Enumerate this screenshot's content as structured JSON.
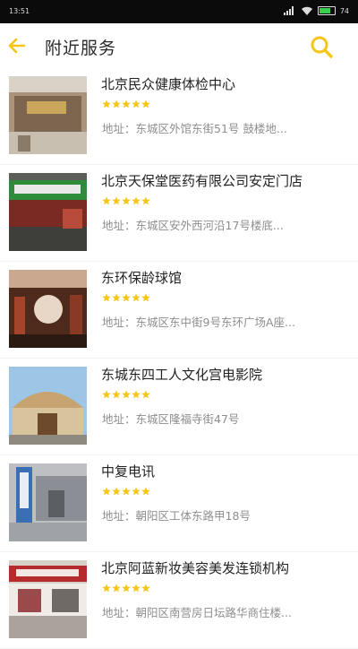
{
  "status_bar": {
    "time": "13:51",
    "battery_percent": "74"
  },
  "header": {
    "title": "附近服务"
  },
  "colors": {
    "accent": "#f5c518",
    "title_text": "#2a2a2a",
    "address_text": "#8e8e8e"
  },
  "rating_max": 5,
  "items": [
    {
      "name": "北京民众健康体检中心",
      "rating": 5,
      "address": "地址：东城区外馆东街51号 鼓楼地..."
    },
    {
      "name": "北京天保堂医药有限公司安定门店",
      "rating": 5,
      "address": "地址：东城区安外西河沿17号楼底..."
    },
    {
      "name": "东环保龄球馆",
      "rating": 5,
      "address": "地址：东城区东中街9号东环广场A座..."
    },
    {
      "name": "东城东四工人文化宫电影院",
      "rating": 5,
      "address": "地址：东城区隆福寺街47号"
    },
    {
      "name": "中复电讯",
      "rating": 5,
      "address": "地址：朝阳区工体东路甲18号"
    },
    {
      "name": "北京阿蓝新妆美容美发连锁机构",
      "rating": 5,
      "address": "地址：朝阳区南营房日坛路华商住楼..."
    }
  ]
}
